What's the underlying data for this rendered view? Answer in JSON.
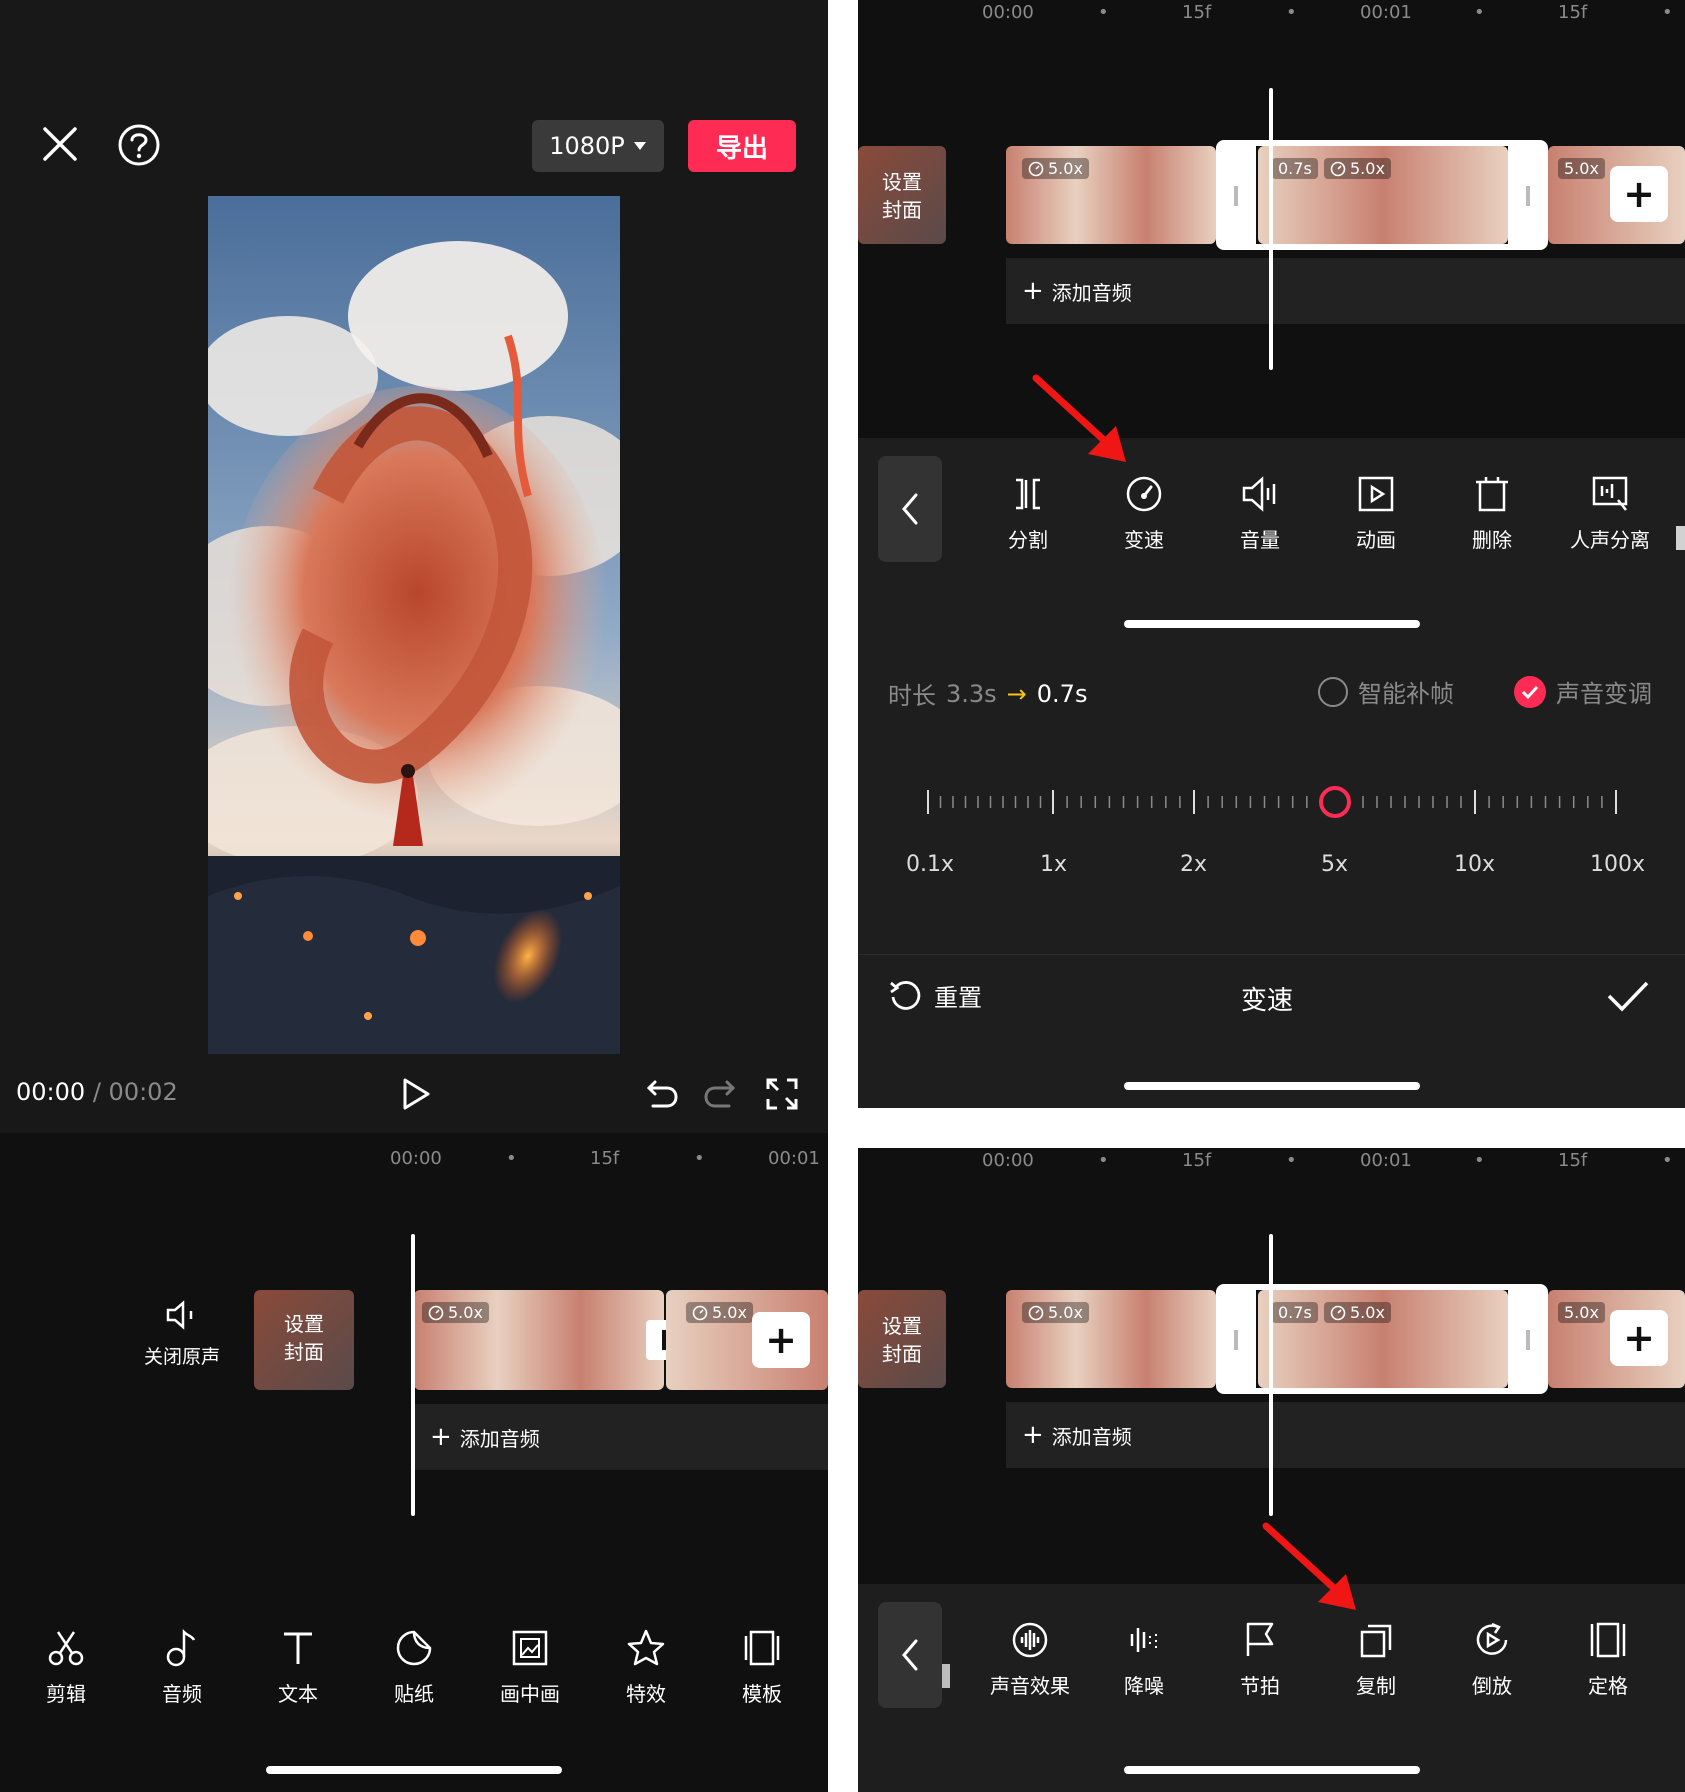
{
  "left": {
    "resolution": "1080P",
    "export_label": "导出",
    "time_current": "00:00",
    "time_sep": "/",
    "time_total": "00:02",
    "ruler": [
      "00:00",
      "15f",
      "00:01"
    ],
    "mute_label": "关闭原声",
    "cover_label": [
      "设置",
      "封面"
    ],
    "speed_tags": [
      "5.0x",
      "5.0x"
    ],
    "add_audio": "添加音频",
    "toolbar": [
      "剪辑",
      "音频",
      "文本",
      "贴纸",
      "画中画",
      "特效",
      "模板"
    ]
  },
  "right_top": {
    "ruler": [
      "00:00",
      "15f",
      "00:01",
      "15f"
    ],
    "cover_label": [
      "设置",
      "封面"
    ],
    "speed_tags": [
      "5.0x",
      "0.7s",
      "5.0x",
      "5.0x"
    ],
    "add_audio": "添加音频",
    "tools": [
      "分割",
      "变速",
      "音量",
      "动画",
      "删除",
      "人声分离"
    ],
    "duration_label": "时长",
    "duration_from": "3.3s",
    "duration_to": "0.7s",
    "smart_frame": "智能补帧",
    "voice_pitch": "声音变调",
    "scale": [
      "0.1x",
      "1x",
      "2x",
      "5x",
      "10x",
      "100x"
    ],
    "speed_value": 5,
    "reset_label": "重置",
    "panel_title": "变速"
  },
  "right_bottom": {
    "ruler": [
      "00:00",
      "15f",
      "00:01",
      "15f"
    ],
    "cover_label": [
      "设置",
      "封面"
    ],
    "speed_tags": [
      "5.0x",
      "0.7s",
      "5.0x",
      "5.0x"
    ],
    "add_audio": "添加音频",
    "tools": [
      "声音效果",
      "降噪",
      "节拍",
      "复制",
      "倒放",
      "定格"
    ]
  },
  "colors": {
    "accent": "#fe2c55",
    "arrow": "#f01616",
    "background": "#101010"
  }
}
